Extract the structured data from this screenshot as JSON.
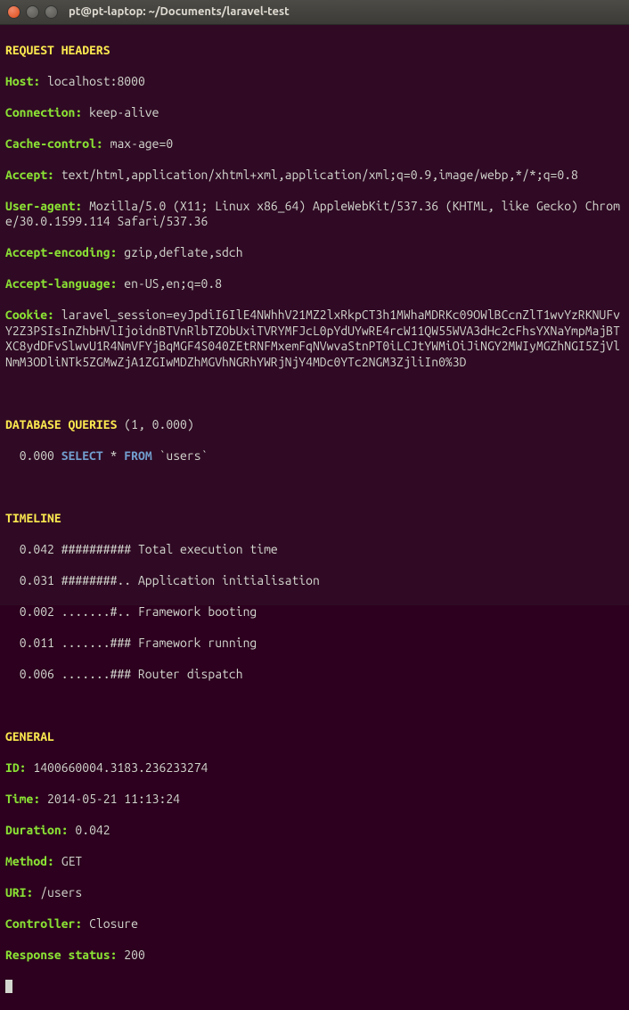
{
  "window": {
    "title": "pt@pt-laptop: ~/Documents/laravel-test"
  },
  "request_headers": {
    "title": "REQUEST HEADERS",
    "host_label": "Host:",
    "host_value": " localhost:8000",
    "connection_label": "Connection:",
    "connection_value": " keep-alive",
    "cache_label": "Cache-control:",
    "cache_value": " max-age=0",
    "accept_label": "Accept:",
    "accept_value": " text/html,application/xhtml+xml,application/xml;q=0.9,image/webp,*/*;q=0.8",
    "ua_label": "User-agent:",
    "ua_value": " Mozilla/5.0 (X11; Linux x86_64) AppleWebKit/537.36 (KHTML, like Gecko) Chrome/30.0.1599.114 Safari/537.36",
    "enc_label": "Accept-encoding:",
    "enc_value": " gzip,deflate,sdch",
    "lang_label": "Accept-language:",
    "lang_value": " en-US,en;q=0.8",
    "cookie_label": "Cookie:",
    "cookie_value": " laravel_session=eyJpdiI6IlE4NWhhV21MZ2lxRkpCT3h1MWhaMDRKc09OWlBCcnZlT1wvYzRKNUFvY2Z3PSIsInZhbHVlIjoidnBTVnRlbTZObUxiTVRYMFJcL0pYdUYwRE4rcW11QW55WVA3dHc2cFhsYXNaYmpMajBTXC8ydDFvSlwvU1R4NmVFYjBqMGF4S040ZEtRNFMxemFqNVwvaStnPT0iLCJtYWMiOiJiNGY2MWIyMGZhNGI5ZjVlNmM3ODliNTk5ZGMwZjA1ZGIwMDZhMGVhNGRhYWRjNjY4MDc0YTc2NGM3ZjliIn0%3D"
  },
  "queries": {
    "title": "DATABASE QUERIES",
    "summary": " (1, 0.000)",
    "row_time": "  0.000 ",
    "kw_select": "SELECT",
    "star": " * ",
    "kw_from": "FROM",
    "table": " `users`"
  },
  "timeline": {
    "title": "TIMELINE",
    "r0": "  0.042 ########## Total execution time",
    "r1": "  0.031 ########.. Application initialisation",
    "r2": "  0.002 .......#.. Framework booting",
    "r3": "  0.011 .......### Framework running",
    "r4": "  0.006 .......### Router dispatch"
  },
  "general": {
    "title": "GENERAL",
    "id_label": "ID:",
    "id_value": " 1400660004.3183.236233274",
    "time_label": "Time:",
    "time_value": " 2014-05-21 11:13:24",
    "dur_label": "Duration:",
    "dur_value": " 0.042",
    "method_label": "Method:",
    "method_value": " GET",
    "uri_label": "URI:",
    "uri_value": " /users",
    "ctrl_label": "Controller:",
    "ctrl_value": " Closure",
    "status_label": "Response status:",
    "status_value": " 200"
  }
}
